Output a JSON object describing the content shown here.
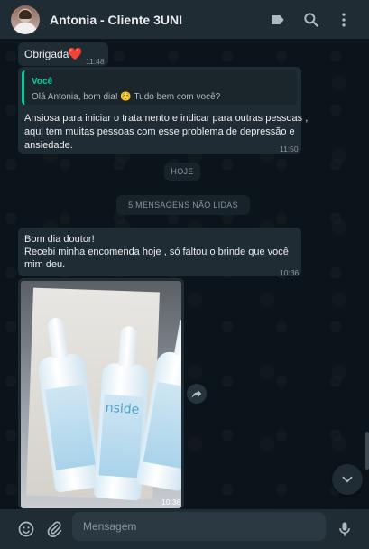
{
  "header": {
    "contact_name": "Antonia - Cliente 3UNI",
    "icons": [
      "label-icon",
      "search-icon",
      "menu-icon"
    ]
  },
  "messages": {
    "m1": {
      "text": "Obrigada",
      "emoji": "❤️",
      "time": "11:48"
    },
    "m2": {
      "quote_author": "Você",
      "quote_text": "Olá Antonia, bom dia! ☺️ Tudo bem com você?",
      "line1": "Ansiosa para iniciar o tratamento e indicar para outras pessoas ,",
      "line2": "aqui tem muitas pessoas com esse problema de depressão e",
      "line3": "ansiedade.",
      "time": "11:50"
    },
    "date_pill": "HOJE",
    "unread_pill": "5 MENSAGENS NÃO LIDAS",
    "m3": {
      "line1": "Bom dia doutor!",
      "line2": "Recebi minha encomenda hoje , só faltou o brinde que você",
      "line3": "mim deu.",
      "time": "10:36"
    },
    "m4": {
      "image_brand": "nside",
      "time": "10:36"
    }
  },
  "footer": {
    "placeholder": "Mensagem",
    "icons": [
      "emoji-icon",
      "attach-icon",
      "mic-icon"
    ]
  },
  "colors": {
    "background": "#0b141a",
    "panel": "#202c33",
    "bubble": "#202c33",
    "accent": "#06cf9c",
    "muted_text": "#8696a0"
  }
}
